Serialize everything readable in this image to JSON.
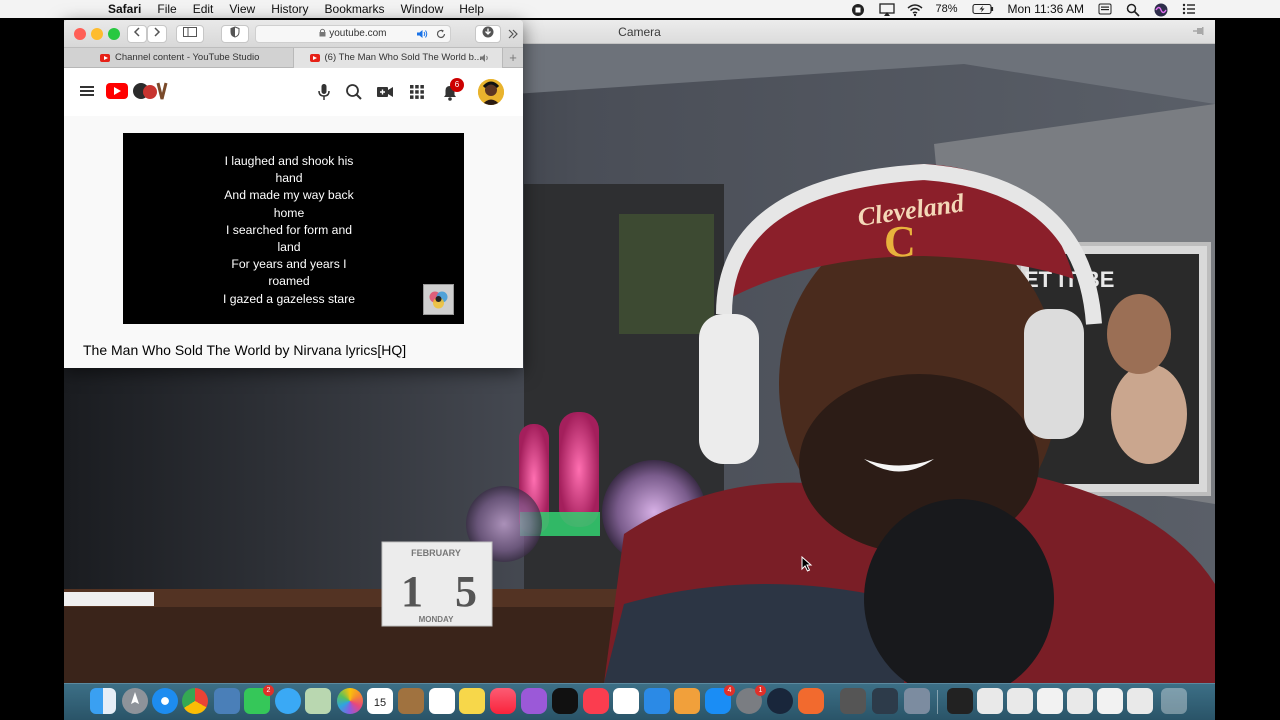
{
  "menubar": {
    "app_name": "Safari",
    "menus": [
      "File",
      "Edit",
      "View",
      "History",
      "Bookmarks",
      "Window",
      "Help"
    ],
    "battery": "78%",
    "clock": "Mon 11:36 AM"
  },
  "camera": {
    "title": "Camera",
    "calendar_month": "FEBRUARY",
    "calendar_day_1": "1",
    "calendar_day_2": "5",
    "calendar_weekday": "MONDAY",
    "cap_text": "Cleveland",
    "cap_letter": "C",
    "poster_text": "ET IT BE"
  },
  "safari": {
    "url": "youtube.com",
    "tabs": [
      {
        "label": "Channel content - YouTube Studio"
      },
      {
        "label": "(6) The Man Who Sold The World b..."
      }
    ],
    "notification_count": "6",
    "video": {
      "lyrics": [
        "I laughed and shook his hand",
        "And made my way back home",
        "I searched for form and land",
        "For years and years I roamed",
        "I gazed a gazeless stare"
      ],
      "title": "The Man Who Sold The World by Nirvana lyrics[HQ]"
    }
  },
  "dock": {
    "messages_badge": "2",
    "calendar_day": "15",
    "appstore_badge": "4",
    "settings_badge": "1"
  },
  "colors": {
    "youtube_red": "#ff0000",
    "dock_blue": "#2f6178"
  }
}
